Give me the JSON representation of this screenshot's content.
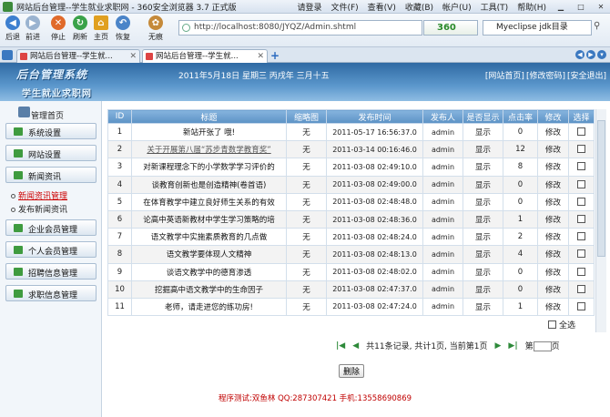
{
  "browser": {
    "title": "网站后台管理--学生就业求职网 - 360安全浏览器 3.7 正式版",
    "menu": [
      "请登录",
      "文件(F)",
      "查看(V)",
      "收藏(B)",
      "帐户(U)",
      "工具(T)",
      "帮助(H)"
    ],
    "toolbar": {
      "back": "后退",
      "forward": "前进",
      "stop": "停止",
      "refresh": "刷新",
      "home": "主页",
      "restore": "恢复",
      "traceless": "无痕"
    },
    "address": "http://localhost:8080/JYQZ/Admin.shtml",
    "engine_badge": "360",
    "search_value": "Myeclipse jdk目录",
    "tabs": [
      {
        "label": "网站后台管理--学生就..."
      },
      {
        "label": "网站后台管理--学生就..."
      }
    ]
  },
  "header": {
    "logo_title": "后台管理系统",
    "site_name": "学生就业求职网",
    "date": "2011年5月18日 星期三 丙戌年 三月十五",
    "links": [
      "[网站首页]",
      "[修改密码]",
      "[安全退出]"
    ]
  },
  "sidebar": {
    "title": "管理首页",
    "menus": [
      {
        "label": "系统设置"
      },
      {
        "label": "网站设置"
      },
      {
        "label": "新闻资讯"
      }
    ],
    "subitems": [
      {
        "label": "新闻资讯管理"
      },
      {
        "label": "发布新闻资讯"
      }
    ],
    "menus2": [
      {
        "label": "企业会员管理"
      },
      {
        "label": "个人会员管理"
      },
      {
        "label": "招聘信息管理"
      },
      {
        "label": "求职信息管理"
      }
    ]
  },
  "table": {
    "headers": [
      "ID",
      "标题",
      "缩略图",
      "发布时间",
      "发布人",
      "是否显示",
      "点击率",
      "修改",
      "选择"
    ],
    "rows": [
      {
        "id": "1",
        "title": "新站开张了 哦!",
        "thumb": "无",
        "time": "2011-05-17 16:56:37.0",
        "author": "admin",
        "show": "显示",
        "clicks": "0",
        "edit": "修改"
      },
      {
        "id": "2",
        "title": "关于开展第八届“苏步青数学教育奖”",
        "thumb": "无",
        "time": "2011-03-14 00:16:46.0",
        "author": "admin",
        "show": "显示",
        "clicks": "12",
        "edit": "修改"
      },
      {
        "id": "3",
        "title": "对新课程理念下的小学数学学习评价的",
        "thumb": "无",
        "time": "2011-03-08 02:49:10.0",
        "author": "admin",
        "show": "显示",
        "clicks": "8",
        "edit": "修改"
      },
      {
        "id": "4",
        "title": "谈教育创新也是创造精神(卷首语)",
        "thumb": "无",
        "time": "2011-03-08 02:49:00.0",
        "author": "admin",
        "show": "显示",
        "clicks": "0",
        "edit": "修改"
      },
      {
        "id": "5",
        "title": "在体育教学中建立良好师生关系的有效",
        "thumb": "无",
        "time": "2011-03-08 02:48:48.0",
        "author": "admin",
        "show": "显示",
        "clicks": "0",
        "edit": "修改"
      },
      {
        "id": "6",
        "title": "论高中英语新教材中学生学习策略的培",
        "thumb": "无",
        "time": "2011-03-08 02:48:36.0",
        "author": "admin",
        "show": "显示",
        "clicks": "1",
        "edit": "修改"
      },
      {
        "id": "7",
        "title": "语文教学中实施素质教育的几点做",
        "thumb": "无",
        "time": "2011-03-08 02:48:24.0",
        "author": "admin",
        "show": "显示",
        "clicks": "2",
        "edit": "修改"
      },
      {
        "id": "8",
        "title": "语文教学要体现人文精神",
        "thumb": "无",
        "time": "2011-03-08 02:48:13.0",
        "author": "admin",
        "show": "显示",
        "clicks": "4",
        "edit": "修改"
      },
      {
        "id": "9",
        "title": "谈语文教学中的德育渗透",
        "thumb": "无",
        "time": "2011-03-08 02:48:02.0",
        "author": "admin",
        "show": "显示",
        "clicks": "0",
        "edit": "修改"
      },
      {
        "id": "10",
        "title": "挖掘高中语文教学中的生命因子",
        "thumb": "无",
        "time": "2011-03-08 02:47:37.0",
        "author": "admin",
        "show": "显示",
        "clicks": "0",
        "edit": "修改"
      },
      {
        "id": "11",
        "title": "老师，请走进您的练功房!",
        "thumb": "无",
        "time": "2011-03-08 02:47:24.0",
        "author": "admin",
        "show": "显示",
        "clicks": "1",
        "edit": "修改"
      }
    ],
    "select_all": "全选"
  },
  "pager": {
    "summary": "共11条记录, 共计1页, 当前第1页",
    "goto_prefix": "第",
    "goto_suffix": "页"
  },
  "actions": {
    "delete": "删除"
  },
  "footer": "程序测试:双鱼林 QQ:287307421 手机:13558690869"
}
